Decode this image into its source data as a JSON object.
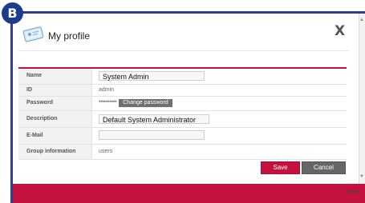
{
  "badge": {
    "letter": "B"
  },
  "dialog": {
    "title": "My profile",
    "close_glyph": "X",
    "footer_close": "close"
  },
  "form": {
    "rows": [
      {
        "label": "Name",
        "value": "System Admin"
      },
      {
        "label": "ID",
        "value": "admin"
      },
      {
        "label": "Password",
        "value": "**********",
        "button": "Change password"
      },
      {
        "label": "Description",
        "value": "Default System Administrator"
      },
      {
        "label": "E-Mail",
        "value": ""
      },
      {
        "label": "Group information",
        "value": "users"
      }
    ]
  },
  "buttons": {
    "save": "Save",
    "cancel": "Cancel"
  },
  "icons": {
    "title": "profile-card-icon",
    "close": "close-icon"
  },
  "colors": {
    "accent": "#c4123f",
    "frame": "#2c3f95",
    "badge": "#1c3d8c"
  }
}
